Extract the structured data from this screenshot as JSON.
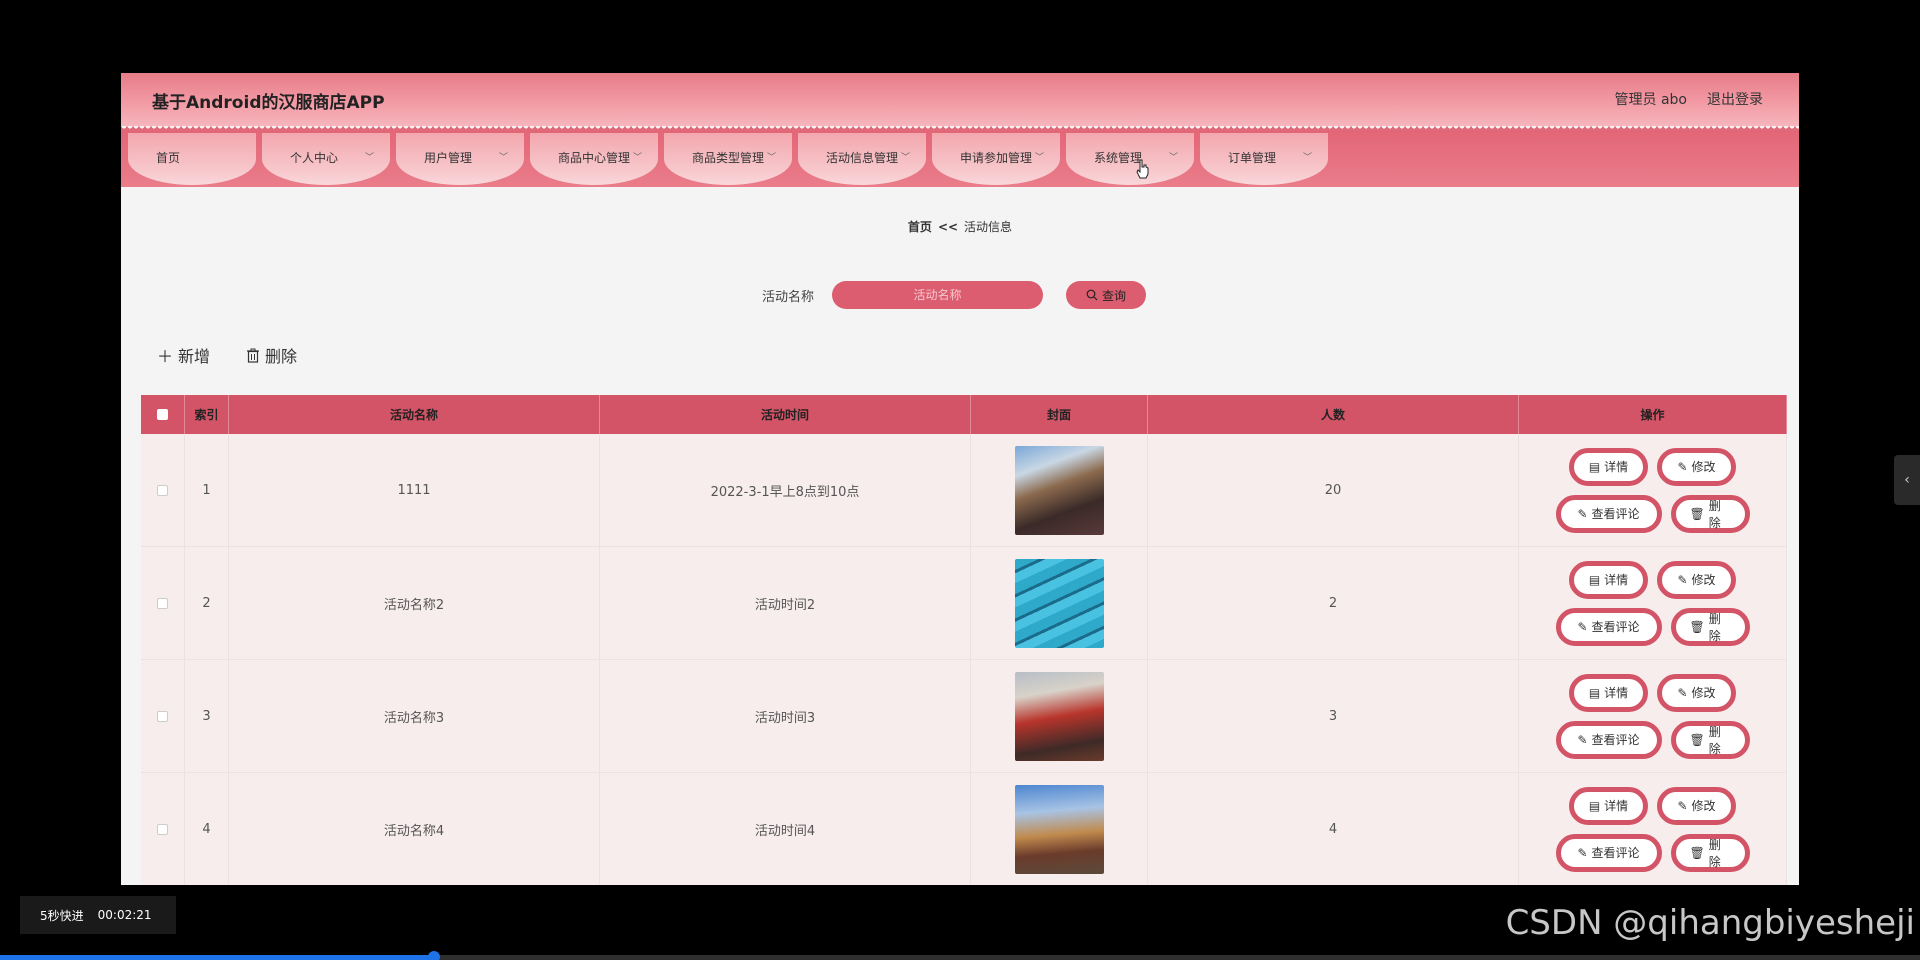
{
  "header": {
    "title": "基于Android的汉服商店APP",
    "admin_label": "管理员 abo",
    "logout": "退出登录"
  },
  "nav": {
    "items": [
      {
        "label": "首页",
        "has_menu": false
      },
      {
        "label": "个人中心",
        "has_menu": true
      },
      {
        "label": "用户管理",
        "has_menu": true
      },
      {
        "label": "商品中心管理",
        "has_menu": true
      },
      {
        "label": "商品类型管理",
        "has_menu": true
      },
      {
        "label": "活动信息管理",
        "has_menu": true
      },
      {
        "label": "申请参加管理",
        "has_menu": true
      },
      {
        "label": "系统管理",
        "has_menu": true
      },
      {
        "label": "订单管理",
        "has_menu": true
      }
    ]
  },
  "breadcrumb": {
    "home": "首页",
    "sep": "<<",
    "current": "活动信息"
  },
  "search": {
    "label": "活动名称",
    "placeholder": "活动名称",
    "button": "查询"
  },
  "actions": {
    "add": "新增",
    "delete": "删除"
  },
  "table": {
    "columns": [
      "",
      "索引",
      "活动名称",
      "活动时间",
      "封面",
      "人数",
      "操作"
    ],
    "rows": [
      {
        "index": "1",
        "name": "1111",
        "time": "2022-3-1早上8点到10点",
        "count": "20"
      },
      {
        "index": "2",
        "name": "活动名称2",
        "time": "活动时间2",
        "count": "2"
      },
      {
        "index": "3",
        "name": "活动名称3",
        "time": "活动时间3",
        "count": "3"
      },
      {
        "index": "4",
        "name": "活动名称4",
        "time": "活动时间4",
        "count": "4"
      }
    ],
    "ops": {
      "detail": "详情",
      "edit": "修改",
      "comments": "查看评论",
      "delete": "删除"
    }
  },
  "player": {
    "skip": "5秒快进",
    "time": "00:02:21",
    "progress": 0.226
  },
  "watermark": "CSDN @qihangbiyesheji",
  "colors": {
    "accent": "#d35466",
    "header_start": "#e77c88",
    "nav_pill": "#f7c7cb"
  }
}
